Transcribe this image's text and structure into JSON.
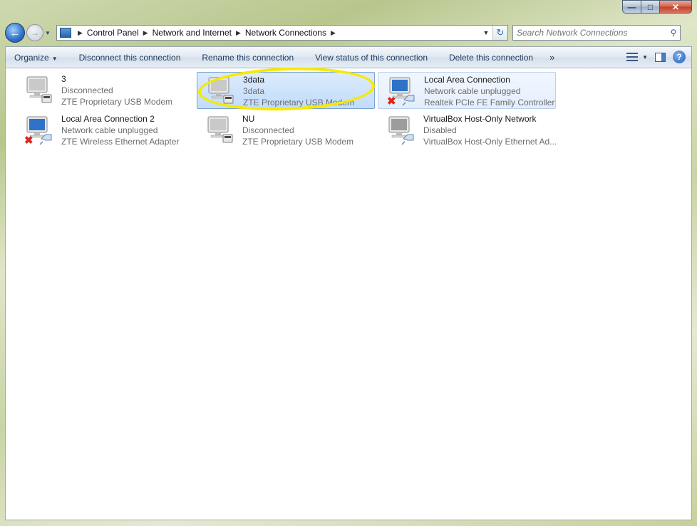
{
  "window": {
    "caption": {
      "minimize": "—",
      "maximize": "□",
      "close": "✕"
    }
  },
  "nav": {
    "back_icon": "back-arrow-icon",
    "forward_icon": "forward-arrow-icon",
    "breadcrumbs": [
      "Control Panel",
      "Network and Internet",
      "Network Connections"
    ],
    "search_placeholder": "Search Network Connections"
  },
  "toolbar": {
    "organize": "Organize",
    "disconnect": "Disconnect this connection",
    "rename": "Rename this connection",
    "view_status": "View status of this connection",
    "delete": "Delete this connection",
    "more": "»"
  },
  "connections": [
    {
      "name": "3",
      "status": "Disconnected",
      "device": "ZTE Proprietary USB Modem",
      "type": "modem",
      "x_mark": false,
      "state": "normal"
    },
    {
      "name": "3data",
      "status": "3data",
      "device": "ZTE Proprietary USB Modem",
      "type": "modem",
      "x_mark": false,
      "state": "selected"
    },
    {
      "name": "Local Area Connection",
      "status": "Network cable unplugged",
      "device": "Realtek PCIe FE Family Controller",
      "type": "ethernet",
      "x_mark": true,
      "state": "hover"
    },
    {
      "name": "Local Area Connection 2",
      "status": "Network cable unplugged",
      "device": "ZTE Wireless Ethernet Adapter",
      "type": "ethernet",
      "x_mark": true,
      "state": "normal"
    },
    {
      "name": "NU",
      "status": "Disconnected",
      "device": "ZTE Proprietary USB Modem",
      "type": "modem",
      "x_mark": false,
      "state": "normal"
    },
    {
      "name": "VirtualBox Host-Only Network",
      "status": "Disabled",
      "device": "VirtualBox Host-Only Ethernet Ad...",
      "type": "ethernet",
      "x_mark": false,
      "state": "normal",
      "disabled": true
    }
  ],
  "colors": {
    "selected_bg": "#c1dcfc",
    "highlight_ring": "#f5ea00",
    "error_x": "#d8281e"
  }
}
